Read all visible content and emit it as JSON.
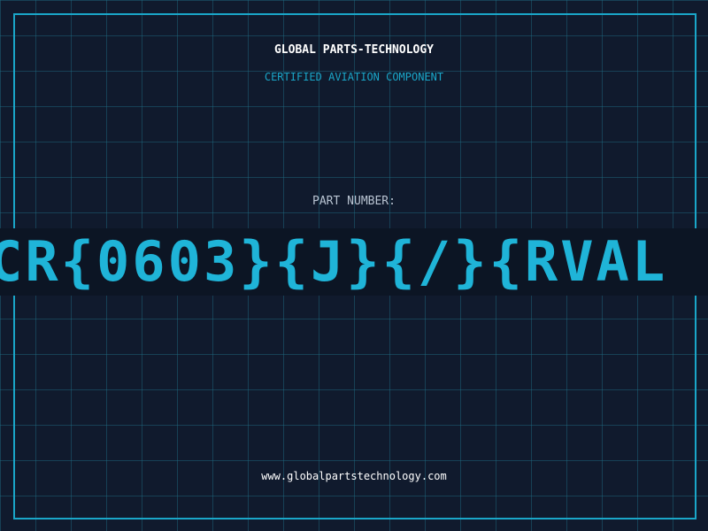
{
  "header": {
    "company_name": "GLOBAL PARTS-TECHNOLOGY",
    "certification": "CERTIFIED AVIATION COMPONENT"
  },
  "part": {
    "label": "PART NUMBER:",
    "number": "CR{0603}{J}{/}{RVAL"
  },
  "footer": {
    "website": "www.globalpartstechnology.com"
  },
  "colors": {
    "background": "#101a2d",
    "grid": "#1f6f85",
    "accent": "#1aa6c8",
    "text": "#ffffff"
  }
}
